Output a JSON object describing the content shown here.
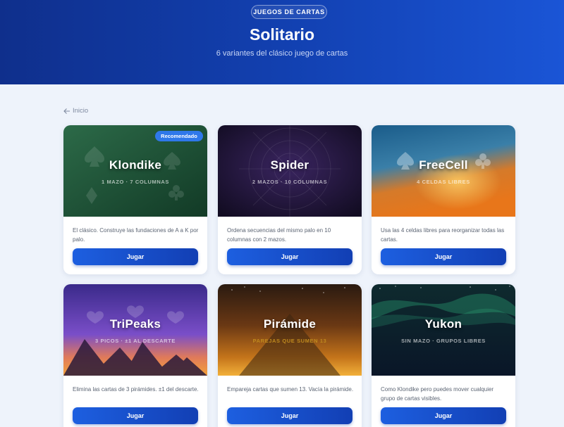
{
  "header": {
    "badge": "JUEGOS DE CARTAS",
    "title": "Solitario",
    "subtitle": "6 variantes del clásico juego de cartas"
  },
  "nav": {
    "back_label": "Inicio"
  },
  "games": [
    {
      "title": "Klondike",
      "meta": "1 MAZO · 7 COLUMNAS",
      "badge": "Recomendado",
      "description": "El clásico. Construye las fundaciones de A a K por palo.",
      "button": "Jugar"
    },
    {
      "title": "Spider",
      "meta": "2 MAZOS · 10 COLUMNAS",
      "description": "Ordena secuencias del mismo palo en 10 columnas con 2 mazos.",
      "button": "Jugar"
    },
    {
      "title": "FreeCell",
      "meta": "4 CELDAS LIBRES",
      "description": "Usa las 4 celdas libres para reorganizar todas las cartas.",
      "button": "Jugar"
    },
    {
      "title": "TriPeaks",
      "meta": "3 PICOS · ±1 AL DESCARTE",
      "description": "Elimina las cartas de 3 pirámides. ±1 del descarte.",
      "button": "Jugar"
    },
    {
      "title": "Pirámide",
      "meta": "PAREJAS QUE SUMEN 13",
      "description": "Empareja cartas que sumen 13. Vacía la pirámide.",
      "button": "Jugar"
    },
    {
      "title": "Yukon",
      "meta": "SIN MAZO · GRUPOS LIBRES",
      "description": "Como Klondike pero puedes mover cualquier grupo de cartas visibles.",
      "button": "Jugar"
    }
  ]
}
